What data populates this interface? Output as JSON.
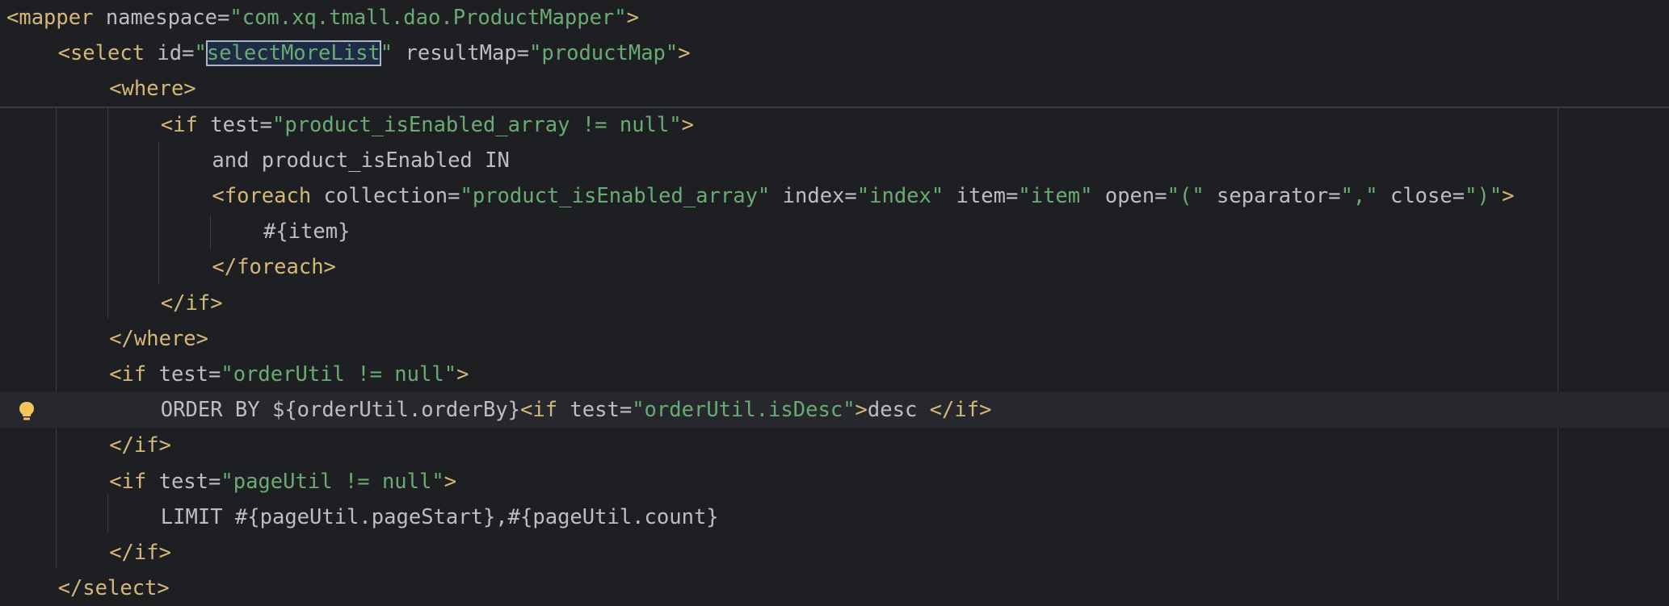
{
  "editor": {
    "lines": [
      [
        {
          "c": "tag",
          "t": "<mapper"
        },
        {
          "c": "attr",
          "t": " namespace"
        },
        {
          "c": "eq",
          "t": "="
        },
        {
          "c": "str",
          "t": "\"com.xq.tmall.dao.ProductMapper\""
        },
        {
          "c": "tag",
          "t": ">"
        }
      ],
      [
        {
          "c": "tag",
          "t": "<select"
        },
        {
          "c": "attr",
          "t": " id"
        },
        {
          "c": "eq",
          "t": "="
        },
        {
          "c": "str",
          "t": "\""
        },
        {
          "c": "str-sel",
          "t": "selectMoreList"
        },
        {
          "c": "str",
          "t": "\""
        },
        {
          "c": "attr",
          "t": " resultMap"
        },
        {
          "c": "eq",
          "t": "="
        },
        {
          "c": "str",
          "t": "\"productMap\""
        },
        {
          "c": "tag",
          "t": ">"
        }
      ],
      [
        {
          "c": "tag",
          "t": "<where>"
        }
      ],
      [
        {
          "c": "tag",
          "t": "<if"
        },
        {
          "c": "attr",
          "t": " test"
        },
        {
          "c": "eq",
          "t": "="
        },
        {
          "c": "str",
          "t": "\"product_isEnabled_array != null\""
        },
        {
          "c": "tag",
          "t": ">"
        }
      ],
      [
        {
          "c": "txt",
          "t": "and product_isEnabled IN"
        }
      ],
      [
        {
          "c": "tag",
          "t": "<foreach"
        },
        {
          "c": "attr",
          "t": " collection"
        },
        {
          "c": "eq",
          "t": "="
        },
        {
          "c": "str",
          "t": "\"product_isEnabled_array\""
        },
        {
          "c": "attr",
          "t": " index"
        },
        {
          "c": "eq",
          "t": "="
        },
        {
          "c": "str",
          "t": "\"index\""
        },
        {
          "c": "attr",
          "t": " item"
        },
        {
          "c": "eq",
          "t": "="
        },
        {
          "c": "str",
          "t": "\"item\""
        },
        {
          "c": "attr",
          "t": " open"
        },
        {
          "c": "eq",
          "t": "="
        },
        {
          "c": "str",
          "t": "\"(\""
        },
        {
          "c": "attr",
          "t": " separator"
        },
        {
          "c": "eq",
          "t": "="
        },
        {
          "c": "str",
          "t": "\",\""
        },
        {
          "c": "attr",
          "t": " close"
        },
        {
          "c": "eq",
          "t": "="
        },
        {
          "c": "str",
          "t": "\")\""
        },
        {
          "c": "tag",
          "t": ">"
        }
      ],
      [
        {
          "c": "txt",
          "t": "#{item}"
        }
      ],
      [
        {
          "c": "tag",
          "t": "</foreach>"
        }
      ],
      [
        {
          "c": "tag",
          "t": "</if>"
        }
      ],
      [
        {
          "c": "tag",
          "t": "</where>"
        }
      ],
      [
        {
          "c": "tag",
          "t": "<if"
        },
        {
          "c": "attr",
          "t": " test"
        },
        {
          "c": "eq",
          "t": "="
        },
        {
          "c": "str",
          "t": "\"orderUtil != null\""
        },
        {
          "c": "tag",
          "t": ">"
        }
      ],
      [
        {
          "c": "txt",
          "t": "ORDER BY ${orderUtil.orderBy}"
        },
        {
          "c": "tag",
          "t": "<if"
        },
        {
          "c": "attr",
          "t": " test"
        },
        {
          "c": "eq",
          "t": "="
        },
        {
          "c": "str",
          "t": "\"orderUtil.isDesc\""
        },
        {
          "c": "tag",
          "t": ">"
        },
        {
          "c": "txt",
          "t": "desc "
        },
        {
          "c": "tag",
          "t": "</if>"
        }
      ],
      [
        {
          "c": "tag",
          "t": "</if>"
        }
      ],
      [
        {
          "c": "tag",
          "t": "<if"
        },
        {
          "c": "attr",
          "t": " test"
        },
        {
          "c": "eq",
          "t": "="
        },
        {
          "c": "str",
          "t": "\"pageUtil != null\""
        },
        {
          "c": "tag",
          "t": ">"
        }
      ],
      [
        {
          "c": "txt",
          "t": "LIMIT #{pageUtil.pageStart},#{pageUtil.count}"
        }
      ],
      [
        {
          "c": "tag",
          "t": "</if>"
        }
      ],
      [
        {
          "c": "tag",
          "t": "</select>"
        }
      ]
    ],
    "indents": [
      0,
      4,
      8,
      12,
      16,
      16,
      20,
      16,
      12,
      8,
      8,
      12,
      8,
      8,
      12,
      8,
      4
    ],
    "caret_line": 11,
    "gutter_icon": "lightbulb-icon"
  }
}
